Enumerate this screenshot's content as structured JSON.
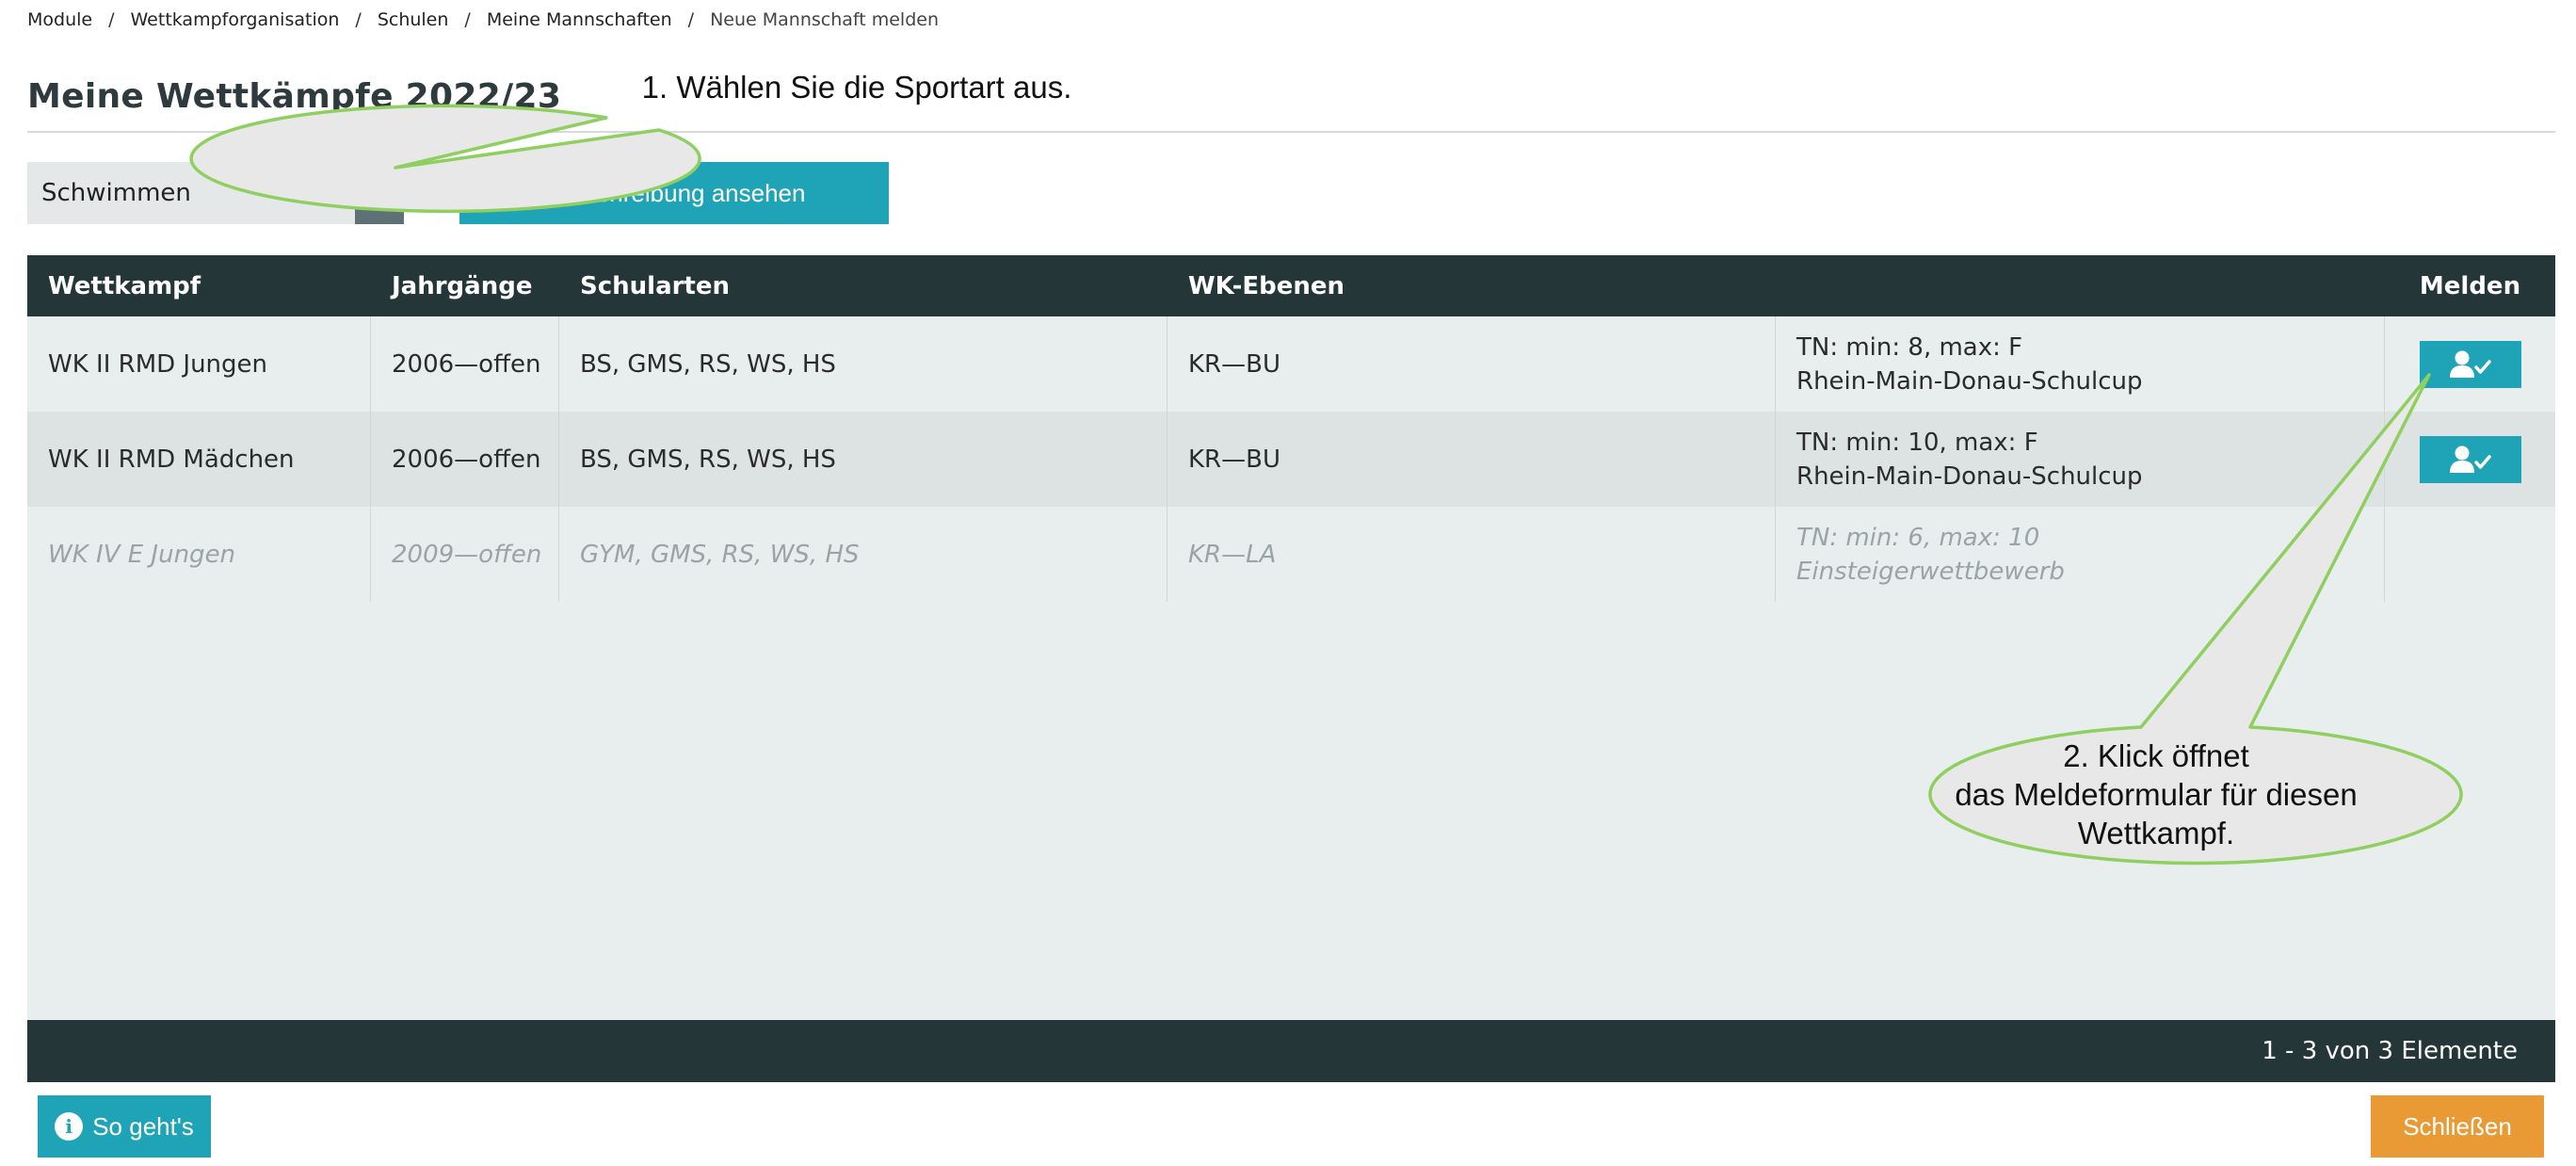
{
  "breadcrumb": [
    "Module",
    "Wettkampforganisation",
    "Schulen",
    "Meine Mannschaften",
    "Neue Mannschaft melden"
  ],
  "breadcrumb_separator": "/",
  "page_title": "Meine Wettkämpfe 2022/23",
  "sport_select": {
    "value": "Schwimmen",
    "icon": "caret-down-icon"
  },
  "ausschreibung_button": "Ausschreibung ansehen",
  "table": {
    "columns": [
      "Wettkampf",
      "Jahrgänge",
      "Schularten",
      "WK-Ebenen",
      "",
      "Melden"
    ],
    "rows": [
      {
        "wettkampf": "WK II RMD Jungen",
        "jahrgaenge": "2006—offen",
        "schularten": "BS, GMS, RS, WS, HS",
        "ebenen": "KR—BU",
        "info1": "TN: min: 8, max: F",
        "info2": "Rhein-Main-Donau-Schulcup",
        "disabled": false
      },
      {
        "wettkampf": "WK II RMD Mädchen",
        "jahrgaenge": "2006—offen",
        "schularten": "BS, GMS, RS, WS, HS",
        "ebenen": "KR—BU",
        "info1": "TN: min: 10, max: F",
        "info2": "Rhein-Main-Donau-Schulcup",
        "disabled": false
      },
      {
        "wettkampf": "WK IV E Jungen",
        "jahrgaenge": "2009—offen",
        "schularten": "GYM, GMS, RS, WS, HS",
        "ebenen": "KR—LA",
        "info1": "TN: min: 6, max: 10",
        "info2": "Einsteigerwettbewerb",
        "disabled": true
      }
    ],
    "pager_text": "1 - 3 von 3 Elemente",
    "melden_icon": "user-check-icon"
  },
  "so_gehts_button": "So geht's",
  "so_gehts_icon": "info-icon",
  "close_button": "Schließen",
  "callout1": "1. Wählen Sie die Sportart aus.",
  "callout2_lines": [
    "2. Klick öffnet",
    "das Meldeformular für diesen",
    "Wettkampf."
  ],
  "colors": {
    "teal": "#1fa4b7",
    "dark_header": "#253638",
    "orange": "#ea9a35",
    "callout_border": "#8fcf5f",
    "callout_fill": "#e8e8e8"
  }
}
